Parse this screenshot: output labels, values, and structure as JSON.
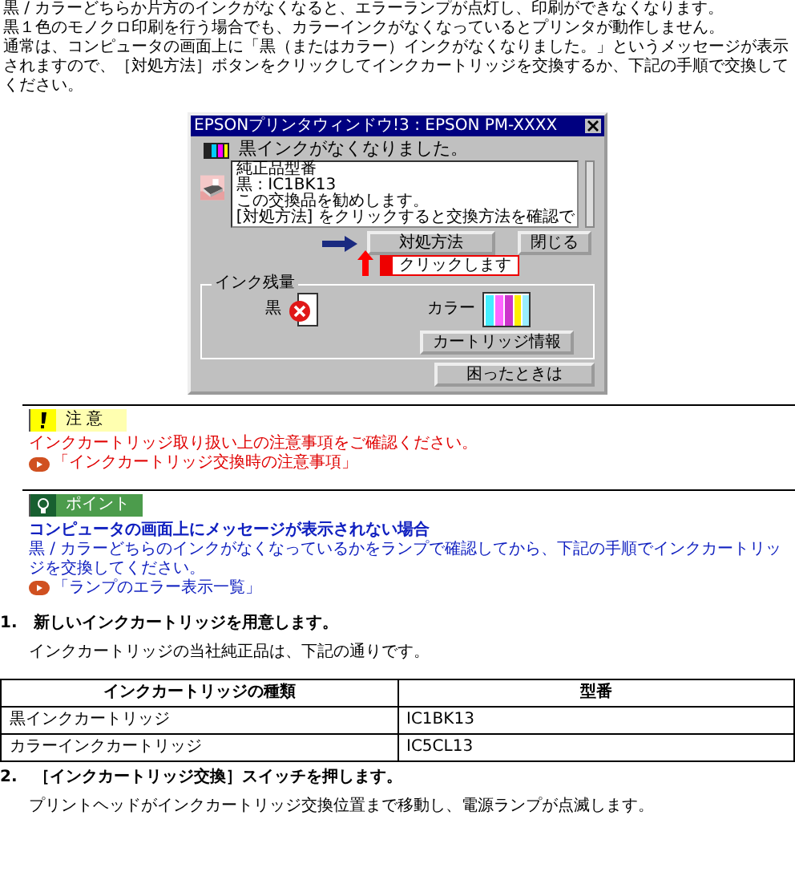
{
  "intro": [
    "黒 / カラーどちらか片方のインクがなくなると、エラーランプが点灯し、印刷ができなくなります。",
    "黒１色のモノクロ印刷を行う場合でも、カラーインクがなくなっているとプリンタが動作しません。",
    "通常は、コンピュータの画面上に「黒（またはカラー）インクがなくなりました。」というメッセージが表示されますので、［対処方法］ボタンをクリックしてインクカートリッジを交換するか、下記の手順で交換してください。"
  ],
  "dialog": {
    "title": "EPSONプリンタウィンドウ!3 : EPSON PM-XXXX",
    "message": "黒インクがなくなりました。",
    "details": [
      "純正品型番",
      "黒 : IC1BK13",
      "この交換品を勧めします。",
      "[対処方法] をクリックすると交換方法を確認で"
    ],
    "action_button": "対処方法",
    "close_button": "閉じる",
    "callout": "クリックします",
    "ink_group": "インク残量",
    "inks": [
      {
        "label": "黒",
        "kind": "black",
        "empty": true
      },
      {
        "label": "カラー",
        "kind": "color",
        "empty": false
      }
    ],
    "info_button": "カートリッジ情報",
    "help_button": "困ったときは"
  },
  "caution": {
    "label": "注 意",
    "text": "インクカートリッジ取り扱い上の注意事項をご確認ください。",
    "link": "「インクカートリッジ交換時の注意事項」"
  },
  "point": {
    "label": "ポイント",
    "heading": "コンピュータの画面上にメッセージが表示されない場合",
    "text": "黒 / カラーどちらのインクがなくなっているかをランプで確認してから、下記の手順でインクカートリッジを交換してください。",
    "link": "「ランプのエラー表示一覧」"
  },
  "steps": [
    {
      "number": "1.",
      "title": "新しいインクカートリッジを用意します。",
      "text": "インクカートリッジの当社純正品は、下記の通りです。",
      "table": {
        "columns": [
          "インクカートリッジの種類",
          "型番"
        ],
        "rows": [
          [
            "黒インクカートリッジ",
            "IC1BK13"
          ],
          [
            "カラーインクカートリッジ",
            "IC5CL13"
          ]
        ]
      }
    },
    {
      "number": "2.",
      "title": "［インクカートリッジ交換］スイッチを押します。",
      "text": "プリントヘッドがインクカートリッジ交換位置まで移動し、電源ランプが点滅します。"
    }
  ]
}
